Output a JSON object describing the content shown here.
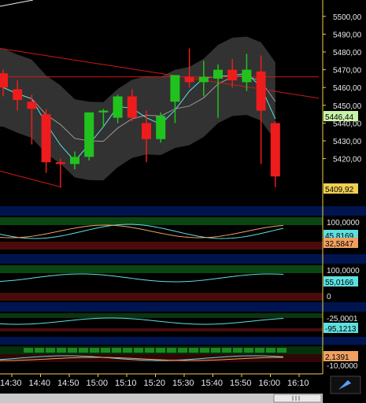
{
  "chart_data": [
    {
      "type": "candlestick",
      "title": "",
      "y_ticks": [
        "5500,00",
        "5490,00",
        "5480,00",
        "5470,00",
        "5460,00",
        "5450,00",
        "5440,00",
        "5430,00",
        "5420,00"
      ],
      "ylim": [
        5403,
        5503
      ],
      "last_price": "5409,92",
      "ma_value": "5446,44",
      "x_ticks": [
        "14:30",
        "14:40",
        "14:50",
        "15:00",
        "15:10",
        "15:20",
        "15:30",
        "15:40",
        "15:50",
        "16:00",
        "16:10"
      ],
      "candles": [
        {
          "o": 5468,
          "h": 5470,
          "l": 5455,
          "c": 5460
        },
        {
          "o": 5459,
          "h": 5464,
          "l": 5447,
          "c": 5453
        },
        {
          "o": 5452,
          "h": 5456,
          "l": 5428,
          "c": 5448
        },
        {
          "o": 5445,
          "h": 5448,
          "l": 5412,
          "c": 5418
        },
        {
          "o": 5418,
          "h": 5420,
          "l": 5404,
          "c": 5417
        },
        {
          "o": 5417,
          "h": 5424,
          "l": 5414,
          "c": 5421
        },
        {
          "o": 5421,
          "h": 5445,
          "l": 5419,
          "c": 5446
        },
        {
          "o": 5446,
          "h": 5448,
          "l": 5438,
          "c": 5447
        },
        {
          "o": 5443,
          "h": 5456,
          "l": 5440,
          "c": 5455
        },
        {
          "o": 5455,
          "h": 5459,
          "l": 5441,
          "c": 5443
        },
        {
          "o": 5440,
          "h": 5447,
          "l": 5418,
          "c": 5431
        },
        {
          "o": 5431,
          "h": 5446,
          "l": 5429,
          "c": 5444
        },
        {
          "o": 5452,
          "h": 5466,
          "l": 5440,
          "c": 5467
        },
        {
          "o": 5466,
          "h": 5482,
          "l": 5460,
          "c": 5463
        },
        {
          "o": 5463,
          "h": 5475,
          "l": 5455,
          "c": 5466
        },
        {
          "o": 5465,
          "h": 5473,
          "l": 5443,
          "c": 5470
        },
        {
          "o": 5470,
          "h": 5476,
          "l": 5460,
          "c": 5464
        },
        {
          "o": 5463,
          "h": 5479,
          "l": 5458,
          "c": 5470
        },
        {
          "o": 5469,
          "h": 5478,
          "l": 5417,
          "c": 5447
        },
        {
          "o": 5440,
          "h": 5441,
          "l": 5404,
          "c": 5410
        }
      ]
    },
    {
      "type": "line",
      "panel": "indicator-1",
      "y_ticks": [
        "100,0000"
      ],
      "value": "45,8169",
      "value2": "32,5847"
    },
    {
      "type": "line",
      "panel": "indicator-2",
      "y_ticks": [
        "100,0000",
        "0"
      ],
      "value": "55,0166"
    },
    {
      "type": "line",
      "panel": "indicator-3",
      "y_ticks": [
        "-25,0001"
      ],
      "value": "-95,1213"
    },
    {
      "type": "bar",
      "panel": "indicator-4",
      "y_ticks": [
        "-10,0000"
      ],
      "value": "2,1391"
    }
  ],
  "colors": {
    "up": "#21c21e",
    "down": "#ee1c1c",
    "band": "#3b3b3b",
    "axis": "#f0d050"
  }
}
